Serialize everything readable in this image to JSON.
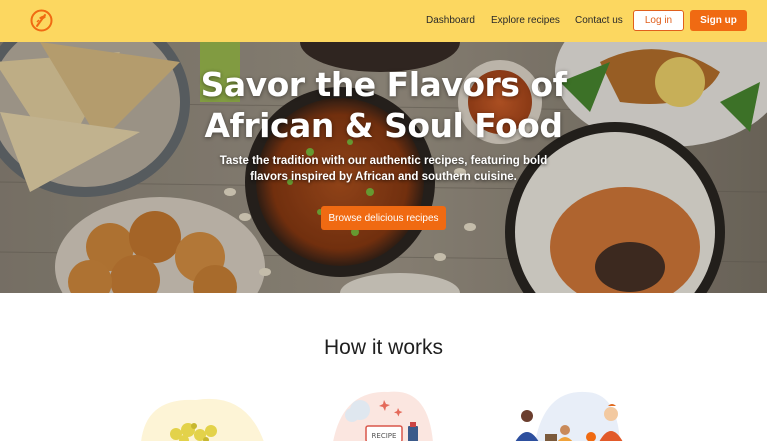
{
  "nav": {
    "logo_icon": "fork-leaf-logo-icon",
    "links": [
      "Dashboard",
      "Explore recipes",
      "Contact us"
    ],
    "login_label": "Log in",
    "signup_label": "Sign up"
  },
  "hero": {
    "title": "Savor the Flavors of African & Soul Food",
    "subtitle": "Taste the tradition with our authentic recipes, featuring bold flavors inspired by African and southern cuisine.",
    "cta_label": "Browse delicious recipes"
  },
  "how_it_works": {
    "title": "How it works",
    "steps": [
      {
        "icon": "food-bowl-illustration-icon"
      },
      {
        "icon": "recipe-card-illustration-icon",
        "card_text": "RECIPE"
      },
      {
        "icon": "family-cooking-illustration-icon"
      }
    ]
  },
  "colors": {
    "nav_background": "#fcd760",
    "accent": "#f06a12",
    "login_border": "#e05f1c"
  }
}
